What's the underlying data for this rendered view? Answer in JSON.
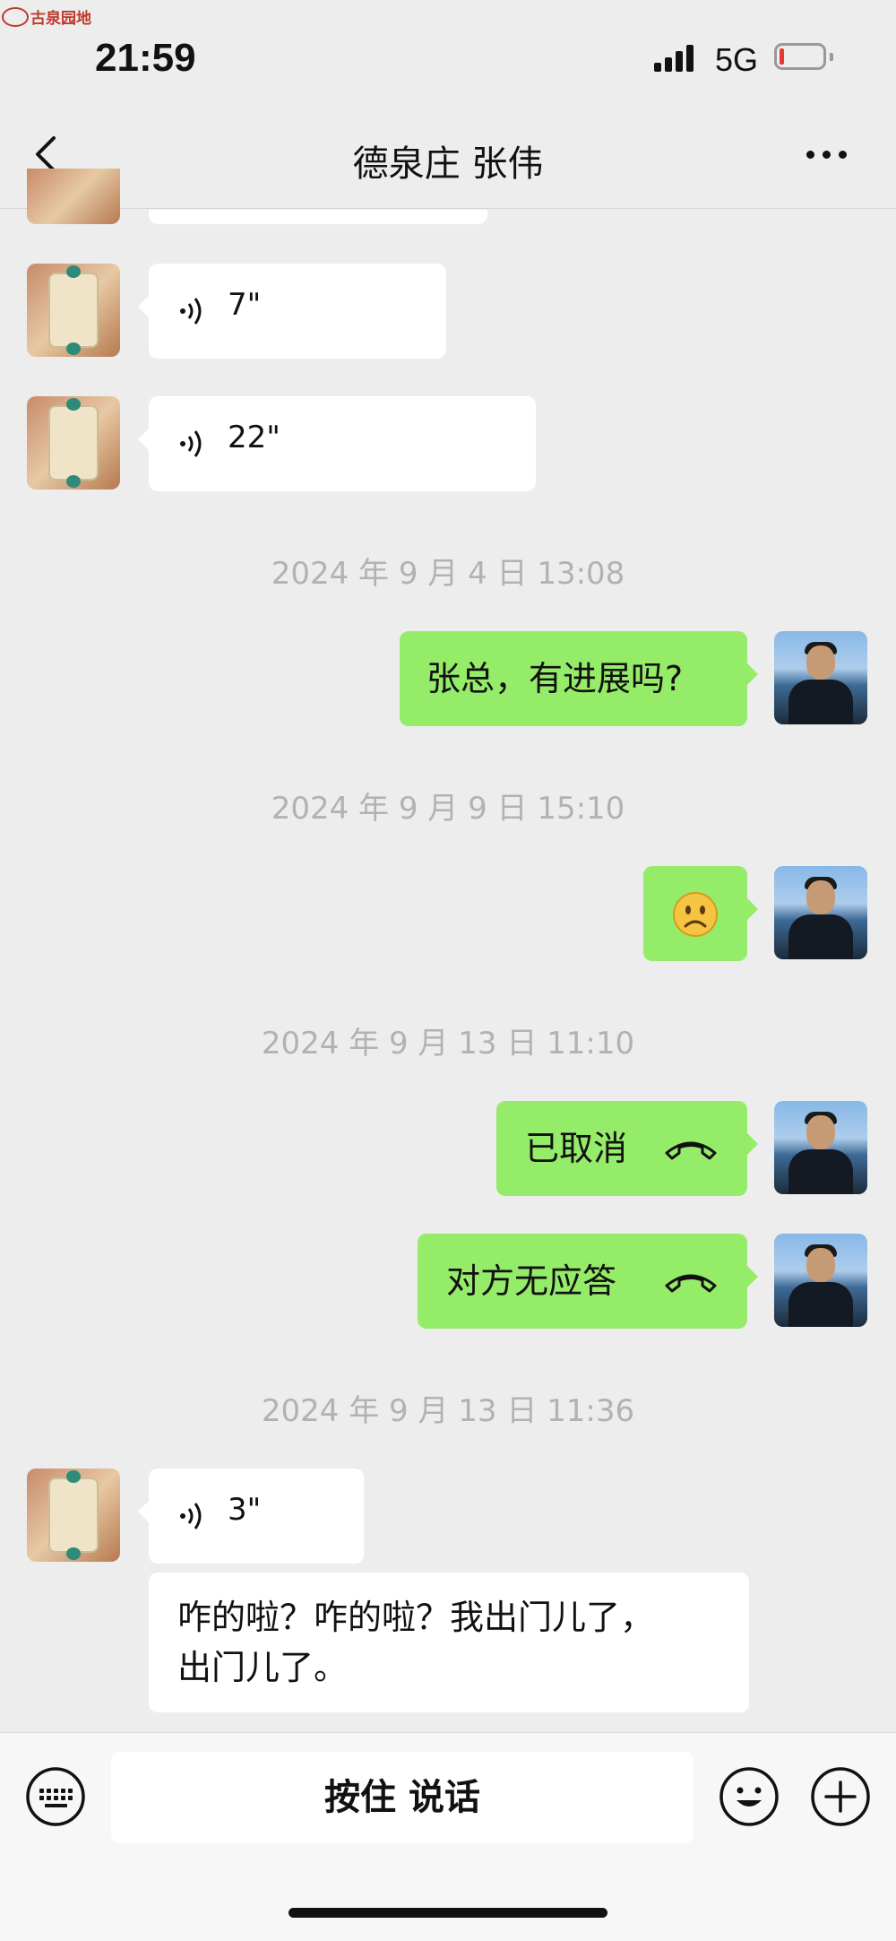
{
  "watermark": "古泉园地",
  "status_bar": {
    "time": "21:59",
    "network": "5G"
  },
  "nav": {
    "title": "德泉庄 张伟"
  },
  "messages": [
    {
      "direction": "incoming",
      "type": "voice",
      "duration": "7\""
    },
    {
      "direction": "incoming",
      "type": "voice",
      "duration": "22\""
    },
    {
      "type": "timestamp",
      "text": "2024 年 9 月 4 日 13:08"
    },
    {
      "direction": "outgoing",
      "type": "text",
      "text": "张总，有进展吗?"
    },
    {
      "type": "timestamp",
      "text": "2024 年 9 月 9 日 15:10"
    },
    {
      "direction": "outgoing",
      "type": "emoji",
      "text": "☹"
    },
    {
      "type": "timestamp",
      "text": "2024 年 9 月 13 日 11:10"
    },
    {
      "direction": "outgoing",
      "type": "call",
      "text": "已取消",
      "icon": "phone-hangup-icon"
    },
    {
      "direction": "outgoing",
      "type": "call",
      "text": "对方无应答",
      "icon": "phone-hangup-icon"
    },
    {
      "type": "timestamp",
      "text": "2024 年 9 月 13 日 11:36"
    },
    {
      "direction": "incoming",
      "type": "voice",
      "duration": "3\""
    },
    {
      "direction": "incoming",
      "type": "transcription",
      "lines": [
        "咋的啦？咋的啦？我出门儿了，",
        "出门儿了。"
      ]
    }
  ],
  "input_bar": {
    "hold_to_talk": "按住 说话",
    "icons": [
      "keyboard-icon",
      "emoji-icon",
      "plus-icon"
    ]
  },
  "colors": {
    "outgoing_bubble": "#95ec69",
    "incoming_bubble": "#ffffff",
    "background": "#ededed",
    "timestamp": "#b2b2b2"
  }
}
